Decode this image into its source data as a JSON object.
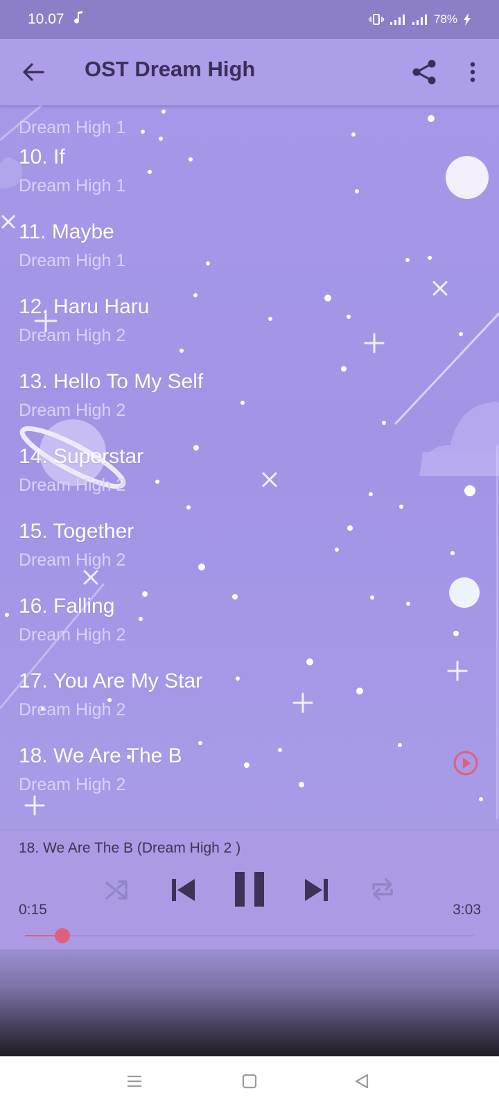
{
  "status_bar": {
    "time": "10.07",
    "battery": "78%"
  },
  "app_bar": {
    "title": "OST Dream High",
    "icons": [
      "back-arrow-icon",
      "share-icon",
      "more-vert-icon"
    ]
  },
  "tracks": [
    {
      "title": "",
      "album": "Dream High 1"
    },
    {
      "title": "10. If",
      "album": "Dream High 1"
    },
    {
      "title": "11. Maybe",
      "album": "Dream High 1"
    },
    {
      "title": "12. Haru Haru",
      "album": "Dream High 2"
    },
    {
      "title": "13. Hello To My Self",
      "album": "Dream High 2"
    },
    {
      "title": "14. Superstar",
      "album": "Dream High 2"
    },
    {
      "title": "15. Together",
      "album": "Dream High 2"
    },
    {
      "title": "16. Falling",
      "album": "Dream High 2"
    },
    {
      "title": "17. You Are My Star",
      "album": "Dream High 2"
    },
    {
      "title": "18. We Are The B",
      "album": "Dream High 2"
    }
  ],
  "player": {
    "now_playing": "18. We Are The B  (Dream High 2 )",
    "current_time": "0:15",
    "total_time": "3:03",
    "progress": 0.083,
    "state": "playing",
    "controls": [
      "shuffle-icon",
      "previous-icon",
      "pause-icon",
      "next-icon",
      "repeat-icon"
    ]
  },
  "colors": {
    "accent": "#e0607a",
    "app_bar": "#ae9de8",
    "status_bar": "#8d7fc7",
    "list_background": "#a697e8",
    "title_text": "#3a2f58"
  }
}
